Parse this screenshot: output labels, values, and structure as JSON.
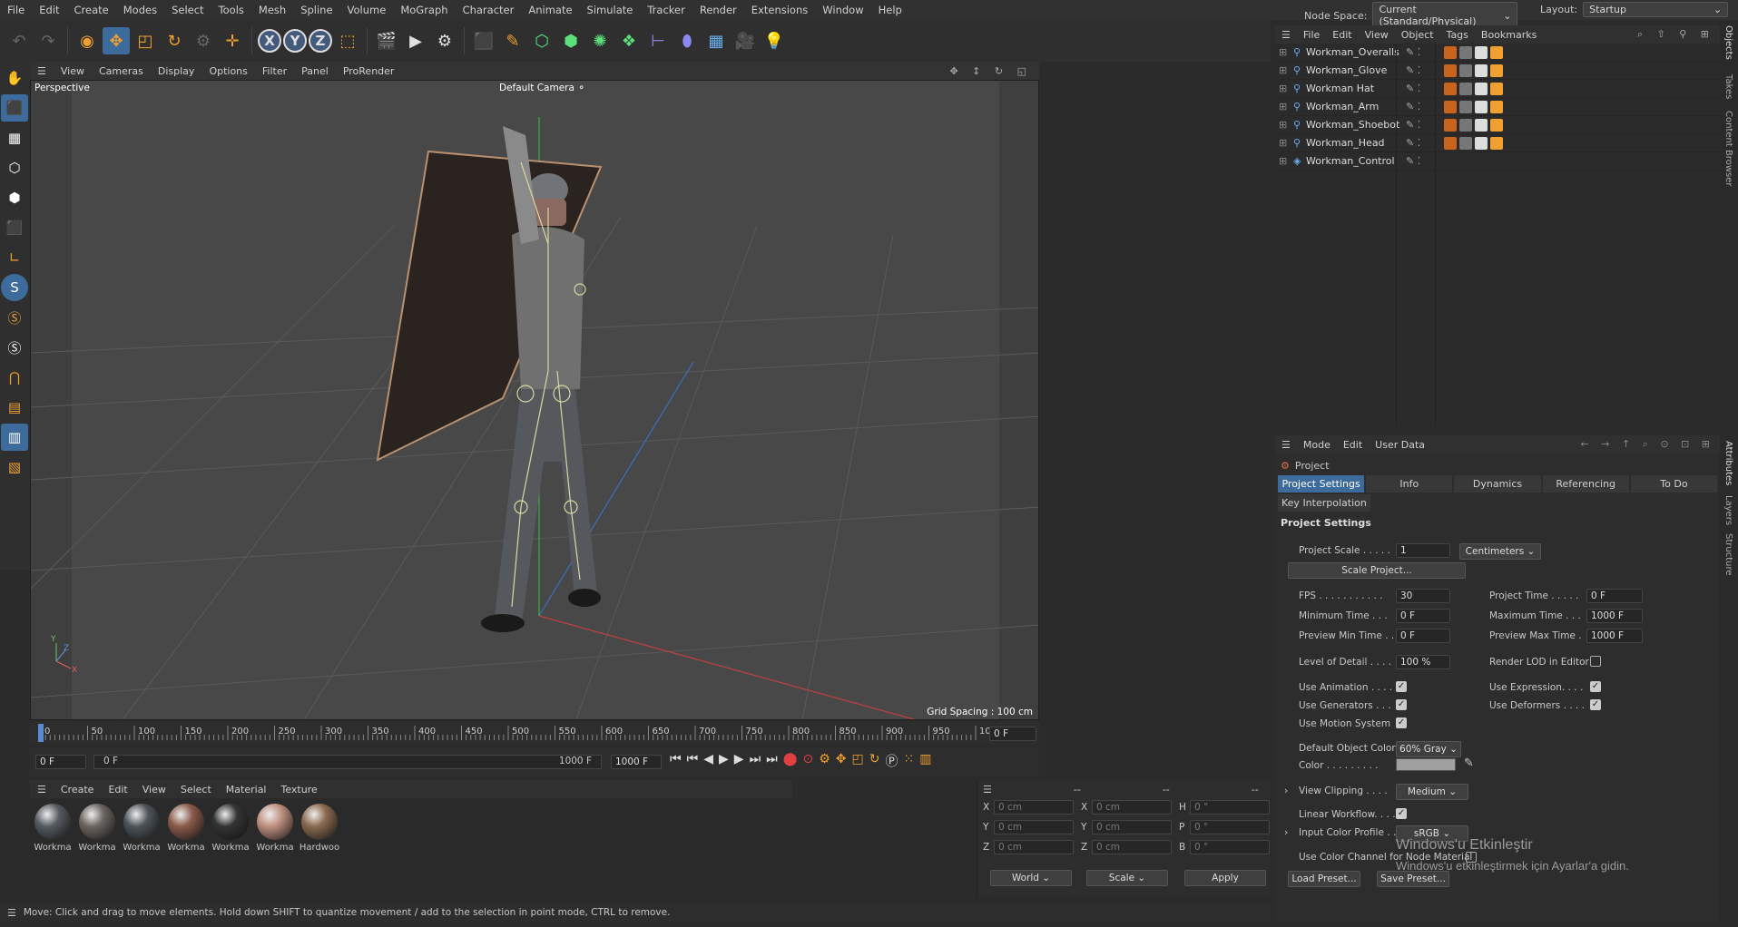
{
  "menu": [
    "File",
    "Edit",
    "Create",
    "Modes",
    "Select",
    "Tools",
    "Mesh",
    "Spline",
    "Volume",
    "MoGraph",
    "Character",
    "Animate",
    "Simulate",
    "Tracker",
    "Render",
    "Extensions",
    "Window",
    "Help"
  ],
  "node_space": {
    "label": "Node Space:",
    "value": "Current (Standard/Physical)"
  },
  "layout": {
    "label": "Layout:",
    "value": "Startup"
  },
  "viewport_menu": [
    "View",
    "Cameras",
    "Display",
    "Options",
    "Filter",
    "Panel",
    "ProRender"
  ],
  "viewport": {
    "name": "Perspective",
    "camera": "Default Camera",
    "grid_spacing": "Grid Spacing : 100 cm"
  },
  "timeline": {
    "ticks": [
      "0",
      "50",
      "100",
      "150",
      "200",
      "250",
      "300",
      "350",
      "400",
      "450",
      "500",
      "550",
      "600",
      "650",
      "700",
      "750",
      "800",
      "850",
      "900",
      "950",
      "100"
    ],
    "current": "0 F"
  },
  "transport": {
    "start": "0 F",
    "range_start": "0 F",
    "range_end": "1000 F",
    "end": "1000 F"
  },
  "mat_menu": [
    "Create",
    "Edit",
    "View",
    "Select",
    "Material",
    "Texture"
  ],
  "materials": [
    {
      "name": "Workma",
      "color": "#555b60"
    },
    {
      "name": "Workma",
      "color": "#6a6560"
    },
    {
      "name": "Workma",
      "color": "#4d545a"
    },
    {
      "name": "Workma",
      "color": "#8a5a4a"
    },
    {
      "name": "Workma",
      "color": "#333333"
    },
    {
      "name": "Workma",
      "color": "#c09080"
    },
    {
      "name": "Hardwoo",
      "color": "#8a6a50"
    }
  ],
  "coord": {
    "headers": [
      "--",
      "--",
      "--"
    ],
    "rows": [
      [
        "X",
        "0 cm",
        "X",
        "0 cm",
        "H",
        "0 °"
      ],
      [
        "Y",
        "0 cm",
        "Y",
        "0 cm",
        "P",
        "0 °"
      ],
      [
        "Z",
        "0 cm",
        "Z",
        "0 cm",
        "B",
        "0 °"
      ]
    ],
    "mode1": "World",
    "mode2": "Scale",
    "apply": "Apply"
  },
  "status": "Move: Click and drag to move elements. Hold down SHIFT to quantize movement / add to the selection in point mode, CTRL to remove.",
  "obj_menu": [
    "File",
    "Edit",
    "View",
    "Object",
    "Tags",
    "Bookmarks"
  ],
  "objects": [
    "Workman_Overalls",
    "Workman_Glove",
    "Workman Hat",
    "Workman_Arm",
    "Workman_Shoebot",
    "Workman_Head",
    "Workman_Control"
  ],
  "attr_menu": [
    "Mode",
    "Edit",
    "User Data"
  ],
  "attr": {
    "title": "Project",
    "tabs": [
      "Project Settings",
      "Info",
      "Dynamics",
      "Referencing",
      "To Do"
    ],
    "tab2": "Key Interpolation",
    "section": "Project Settings",
    "project_scale_label": "Project Scale . . . . .",
    "project_scale": "1",
    "units": "Centimeters",
    "scale_btn": "Scale Project...",
    "fps_label": "FPS . . . . . . . . . . .",
    "fps": "30",
    "project_time_label": "Project Time . . . . .",
    "project_time": "0 F",
    "min_time_label": "Minimum Time . . .",
    "min_time": "0 F",
    "max_time_label": "Maximum Time . . .",
    "max_time": "1000 F",
    "prev_min_label": "Preview Min Time . .",
    "prev_min": "0 F",
    "prev_max_label": "Preview Max Time .",
    "prev_max": "1000 F",
    "lod_label": "Level of Detail . . . .",
    "lod": "100 %",
    "render_lod_label": "Render LOD in Editor",
    "use_anim": "Use Animation . . . .",
    "use_expr": "Use Expression. . . .",
    "use_gen": "Use Generators . . .",
    "use_def": "Use Deformers . . . .",
    "use_motion": "Use Motion System",
    "def_color_label": "Default Object Color",
    "def_color": "60% Gray",
    "color_label": "Color . . . . . . . . .",
    "view_clip_label": "View Clipping . . . .",
    "view_clip": "Medium",
    "linear_label": "Linear Workflow. . . .",
    "input_profile_label": "Input Color Profile . .",
    "input_profile": "sRGB",
    "color_channel_label": "Use Color Channel for Node Material",
    "load_preset": "Load Preset...",
    "save_preset": "Save Preset..."
  },
  "watermark": {
    "line1": "Windows'u Etkinleştir",
    "line2": "Windows'u etkinleştirmek için Ayarlar'a gidin."
  },
  "right_tabs": [
    "Objects",
    "Takes",
    "Content Browser",
    "Attributes",
    "Layers",
    "Structure"
  ]
}
